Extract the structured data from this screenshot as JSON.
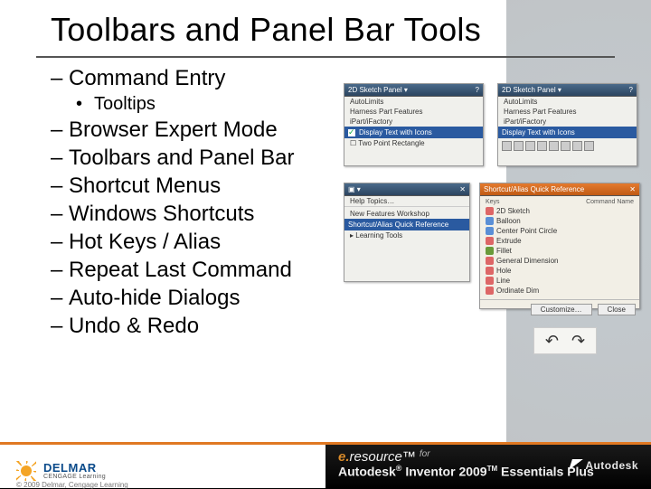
{
  "title": "Toolbars and Panel Bar Tools",
  "bullets": {
    "b1": "Command Entry",
    "b1a": "Tooltips",
    "b2": "Browser Expert Mode",
    "b3": "Toolbars and Panel Bar",
    "b4": "Shortcut Menus",
    "b5": "Windows Shortcuts",
    "b6": "Hot Keys / Alias",
    "b7": "Repeat Last Command",
    "b8": "Auto-hide Dialogs",
    "b9": "Undo & Redo"
  },
  "panels": {
    "p1": {
      "header": "2D Sketch Panel ▾",
      "rows": [
        "AutoLimits",
        "Harness Part Features",
        "iPart/iFactory"
      ],
      "highlight": "Display Text with Icons",
      "after": "Two Point Rectangle"
    },
    "p2": {
      "header": "2D Sketch Panel ▾",
      "rows": [
        "AutoLimits",
        "Harness Part Features",
        "iPart/iFactory"
      ],
      "highlight": "Display Text with Icons"
    },
    "p3": {
      "menu": [
        "Help Topics…",
        "",
        "New Features Workshop",
        "Shortcut/Alias Quick Reference",
        "Learning Tools"
      ]
    },
    "p4": {
      "header": "Shortcut/Alias Quick Reference",
      "col1": "Keys",
      "col2": "Command Name",
      "items": [
        "2D Sketch",
        "Balloon",
        "Center Point Circle",
        "Extrude",
        "Fillet",
        "General Dimension",
        "Hole",
        "Line",
        "Ordinate Dim"
      ],
      "btn1": "Customize…",
      "btn2": "Close"
    }
  },
  "footer": {
    "brand1": "DELMAR",
    "brand2": "CENGAGE Learning",
    "copy": "© 2009 Delmar, Cengage Learning",
    "eres_e": "e.",
    "eres_r": "resource",
    "eres_for": "for",
    "product": "Autodesk® Inventor 2009™ Essentials Plus",
    "autodesk": "Autodesk"
  }
}
